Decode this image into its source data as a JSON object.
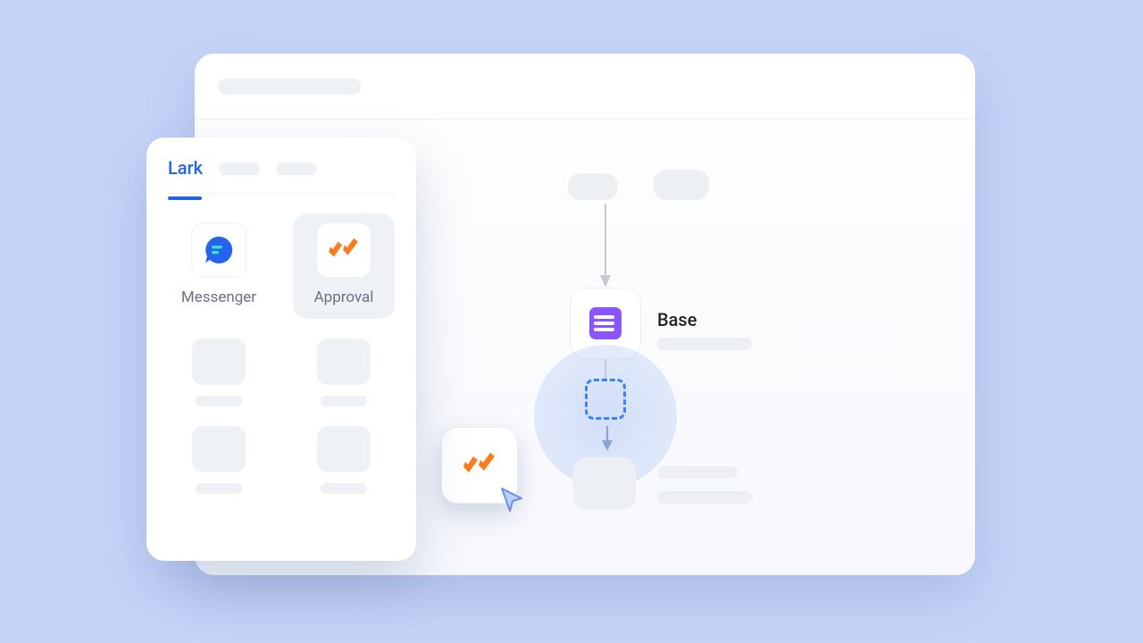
{
  "canvas": {},
  "picker": {
    "tabs": {
      "active": "Lark"
    },
    "apps": {
      "messenger": "Messenger",
      "approval": "Approval"
    }
  },
  "flow": {
    "base_label": "Base"
  },
  "colors": {
    "page_bg": "#c6d4f9",
    "accent_blue": "#2463eb",
    "approval_orange": "#ff7a1a",
    "base_purple": "#8b54ff"
  }
}
